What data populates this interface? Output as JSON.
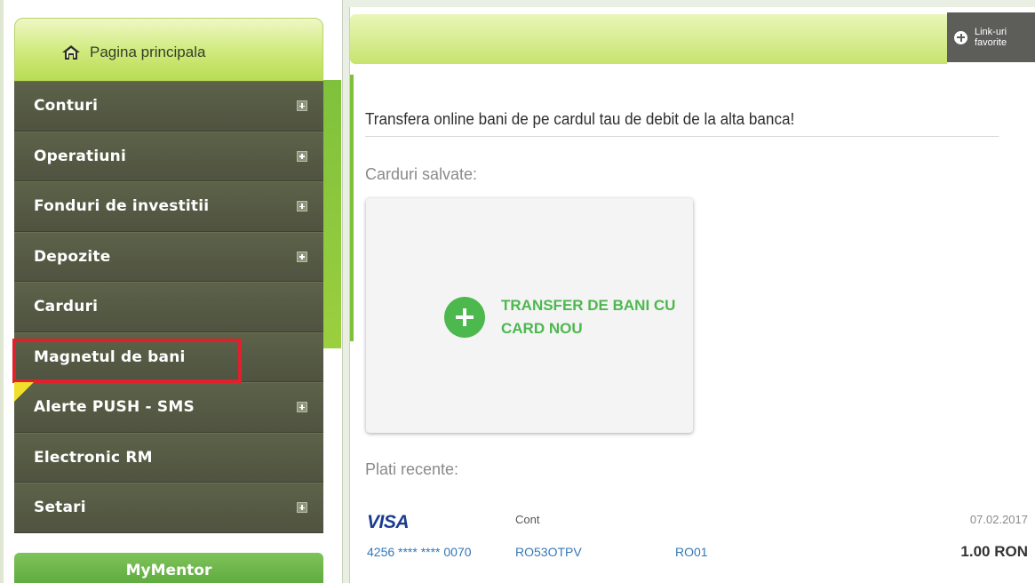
{
  "sidebar": {
    "home_label": "Pagina principala",
    "items": [
      {
        "label": "Conturi",
        "expandable": true
      },
      {
        "label": "Operatiuni",
        "expandable": true
      },
      {
        "label": "Fonduri de investitii",
        "expandable": true
      },
      {
        "label": "Depozite",
        "expandable": true
      },
      {
        "label": "Carduri",
        "expandable": false
      },
      {
        "label": "Magnetul de bani",
        "expandable": false
      },
      {
        "label": "Alerte PUSH - SMS",
        "expandable": true
      },
      {
        "label": "Electronic RM",
        "expandable": false
      },
      {
        "label": "Setari",
        "expandable": true
      }
    ],
    "mentor_label": "MyMentor"
  },
  "header": {
    "favorites_label": "Link-uri favorite"
  },
  "main": {
    "title": "Transfera online bani de pe cardul tau de debit de la alta banca!",
    "saved_cards_heading": "Carduri salvate:",
    "add_card_label": "TRANSFER DE BANI CU CARD NOU",
    "recent_heading": "Plati recente:",
    "recent_payment": {
      "brand": "VISA",
      "account_heading": "Cont",
      "date": "07.02.2017",
      "card_number": "4256 **** **** 0070",
      "from_account": "RO53OTPV",
      "to_account": "RO01",
      "amount": "1.00 RON"
    }
  },
  "colors": {
    "menu_bg": "#585c46",
    "accent_green": "#4cb84e",
    "highlight_red": "#e0202a",
    "link_blue": "#3378b8"
  }
}
